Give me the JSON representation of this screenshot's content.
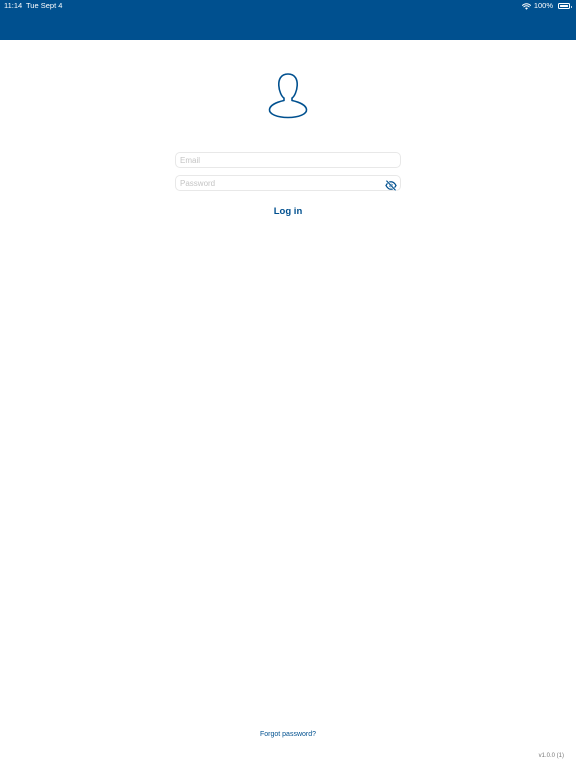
{
  "status_bar": {
    "time": "11:14",
    "date": "Tue Sept 4",
    "battery": "100%",
    "icons": [
      "wifi-icon",
      "battery-icon"
    ]
  },
  "login": {
    "avatar_icon": "person-outline-icon",
    "email_placeholder": "Email",
    "email_value": "",
    "password_placeholder": "Password",
    "password_value": "",
    "visibility_icon": "eye-slash-icon",
    "login_label": "Log in"
  },
  "footer": {
    "forgot_password": "Forgot password?",
    "version": "v1.0.0 (1)"
  },
  "colors": {
    "header": "#00508f",
    "accent": "#00508f",
    "background": "#ffffff",
    "field_border": "#e8e8e8"
  }
}
